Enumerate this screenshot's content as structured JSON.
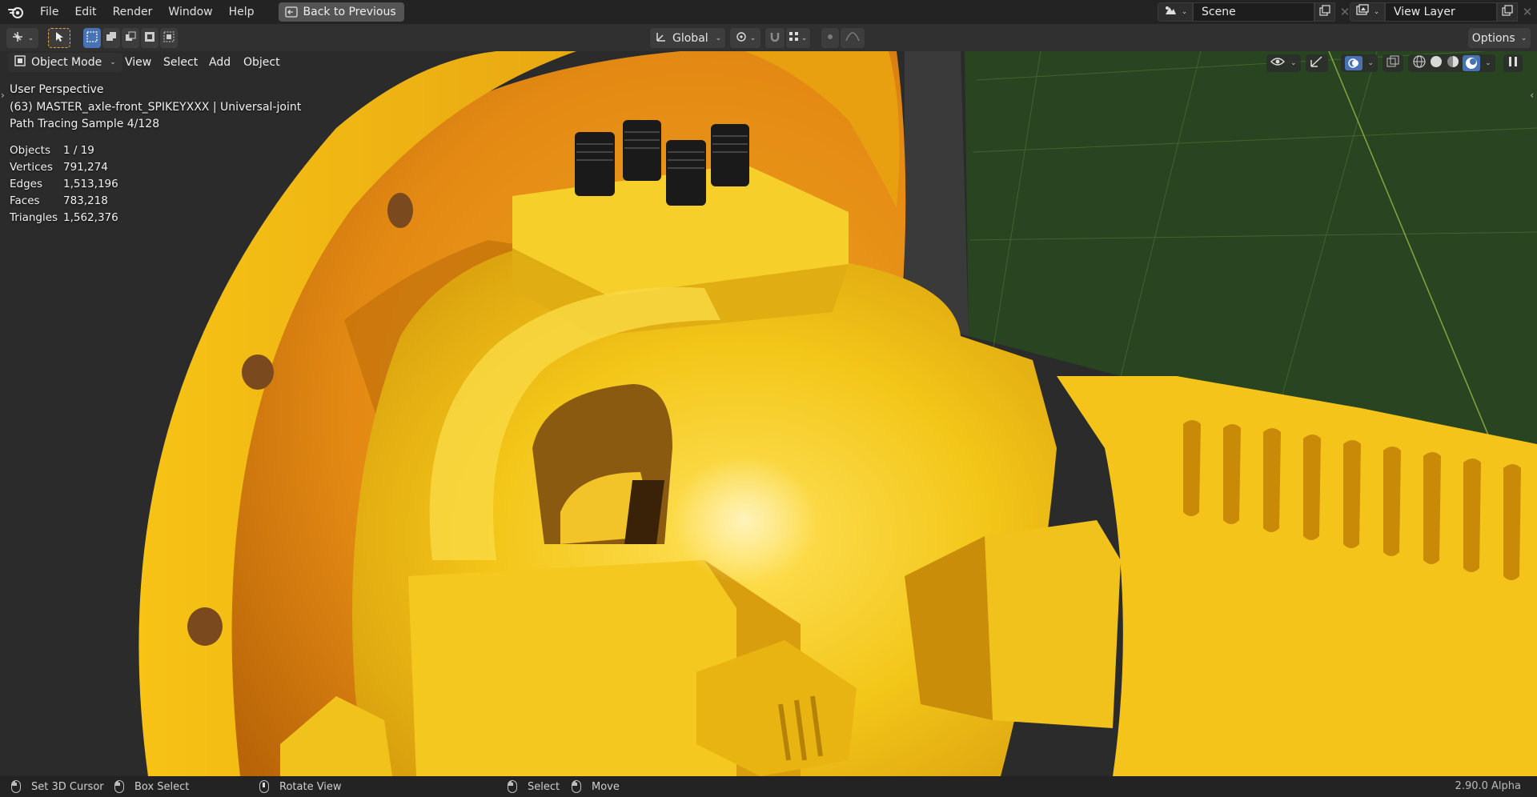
{
  "menubar": {
    "items": [
      "File",
      "Edit",
      "Render",
      "Window",
      "Help"
    ],
    "back_button": "Back to Previous",
    "scene": {
      "label": "Scene"
    },
    "view_layer": {
      "label": "View Layer"
    }
  },
  "toolbar": {
    "orientation": "Global",
    "options_label": "Options"
  },
  "viewport": {
    "mode": "Object Mode",
    "menus": [
      "View",
      "Select",
      "Add",
      "Object"
    ],
    "perspective": "User Perspective",
    "object_info": "(63) MASTER_axle-front_SPIKEYXXX | Universal-joint",
    "render_progress": "Path Tracing Sample 4/128",
    "stats": [
      {
        "label": "Objects",
        "value": "1 / 19"
      },
      {
        "label": "Vertices",
        "value": "791,274"
      },
      {
        "label": "Edges",
        "value": "1,513,196"
      },
      {
        "label": "Faces",
        "value": "783,218"
      },
      {
        "label": "Triangles",
        "value": "1,562,376"
      }
    ]
  },
  "statusbar": {
    "set_cursor": "Set 3D Cursor",
    "box_select": "Box Select",
    "rotate_view": "Rotate View",
    "select": "Select",
    "move": "Move",
    "version": "2.90.0 Alpha"
  },
  "colors": {
    "model_yellow": "#f2c714",
    "ground_green": "#2d4a22",
    "accent_blue": "#4772b3"
  }
}
